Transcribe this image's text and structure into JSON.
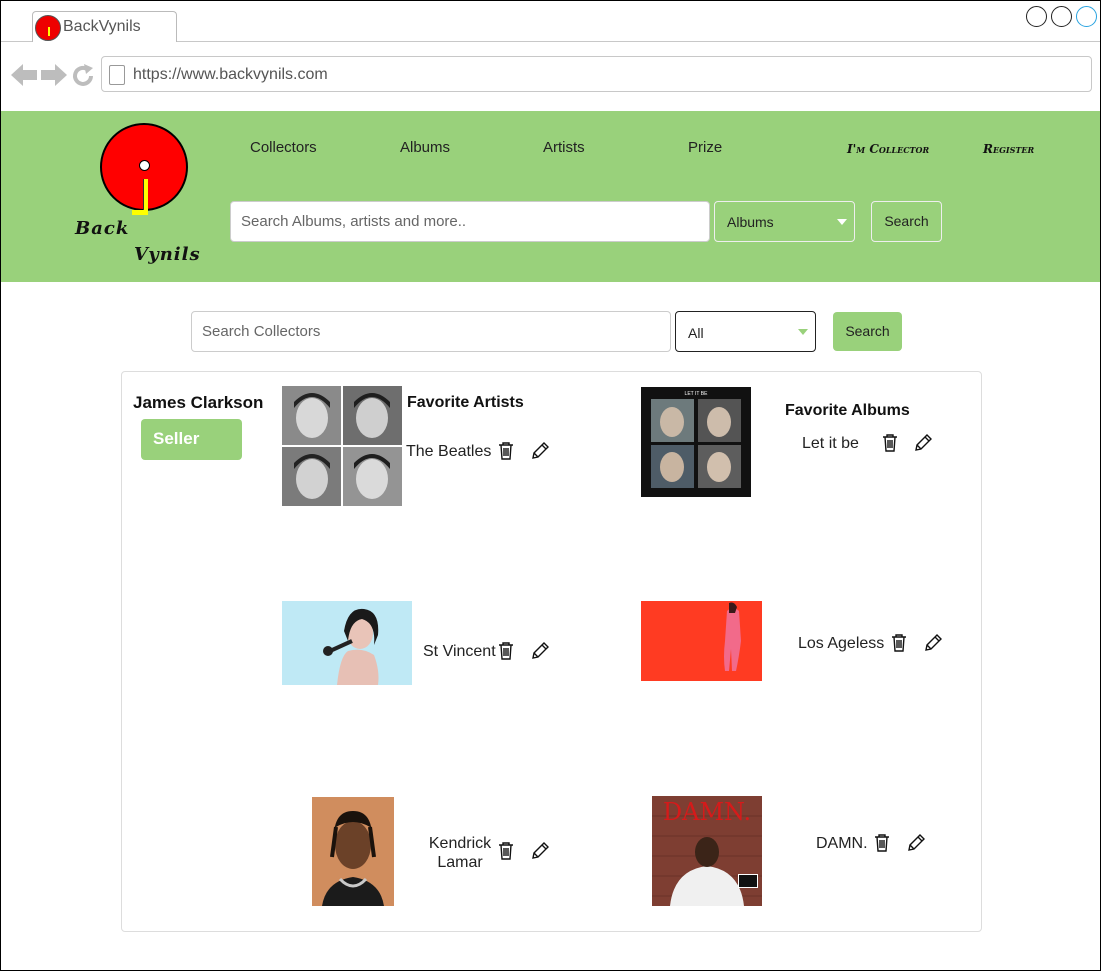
{
  "browser": {
    "tab_title": "BackVynils",
    "url": "https://www.backvynils.com"
  },
  "header": {
    "logo_line1": "Back",
    "logo_line2": "Vynils",
    "nav": [
      "Collectors",
      "Albums",
      "Artists",
      "Prize"
    ],
    "im_collector": "I'm Collector",
    "register": "Register",
    "search_placeholder": "Search Albums, artists and more..",
    "search_category": "Albums",
    "search_button": "Search"
  },
  "collectors_search": {
    "placeholder": "Search Collectors",
    "filter": "All",
    "button": "Search"
  },
  "profile": {
    "name": "James Clarkson",
    "badge": "Seller",
    "favorite_artists_title": "Favorite Artists",
    "favorite_albums_title": "Favorite Albums",
    "artists": [
      {
        "name": "The Beatles"
      },
      {
        "name": "St Vincent"
      },
      {
        "name": "Kendrick Lamar"
      }
    ],
    "albums": [
      {
        "name": "Let it be",
        "cover_text": "LET IT BE"
      },
      {
        "name": "Los Ageless"
      },
      {
        "name": "DAMN.",
        "cover_text": "DAMN."
      }
    ]
  },
  "colors": {
    "brand_green": "#99d17b",
    "logo_red": "#ff0000",
    "logo_yellow": "#ffff00"
  }
}
